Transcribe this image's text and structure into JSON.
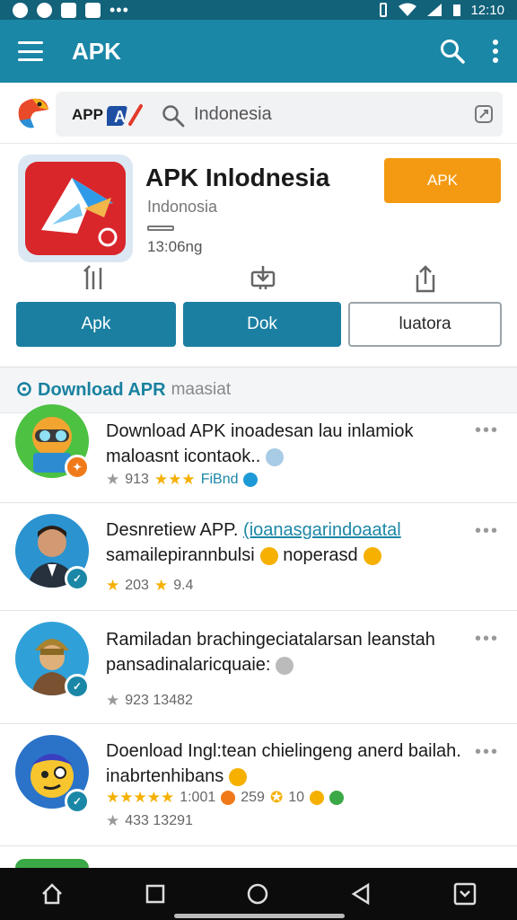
{
  "status_bar": {
    "time": "12:10"
  },
  "app_bar": {
    "title": "APK"
  },
  "search": {
    "brand_text": "APP",
    "query": "Indonesia"
  },
  "hero": {
    "title": "APK Inlodnesia",
    "subtitle": "Indonosia",
    "size": "13:06ng",
    "cta_label": "APK",
    "buttons": [
      "Apk",
      "Dok",
      "luatora"
    ]
  },
  "section": {
    "title": "Download APR",
    "subtitle": "maasiat"
  },
  "items": [
    {
      "title_line1": "Download APK inoadesan lau inlamiok",
      "title_line2": "maloasnt icontaok..",
      "meta": "913",
      "meta_extra": "FiBnd"
    },
    {
      "title_line1": "Desnretiew APP. ",
      "title_link": "(ioanasgarindoaatal",
      "title_line2": "samailepirannbulsi",
      "title_line2b": "noperasd",
      "meta": "203",
      "meta_extra": "9.4"
    },
    {
      "title_line1": "Ramiladan brachingeciatalarsan leanstah",
      "title_line2": "pansadinalaricquaie:",
      "meta": "923 13482"
    },
    {
      "title_line1": "Doenload Ingl:tean chielingeng anerd bailah.",
      "title_line2": "inabrtenhibans",
      "rating_line": "1:001",
      "rating_extra1": "259",
      "rating_extra2": "10",
      "meta": "433 13291"
    }
  ],
  "colors": {
    "status_bar": "#12627a",
    "app_bar": "#1b87a6",
    "cta_orange": "#f49a12",
    "primary_button": "#1b7fa2",
    "section_title": "#18819f"
  }
}
